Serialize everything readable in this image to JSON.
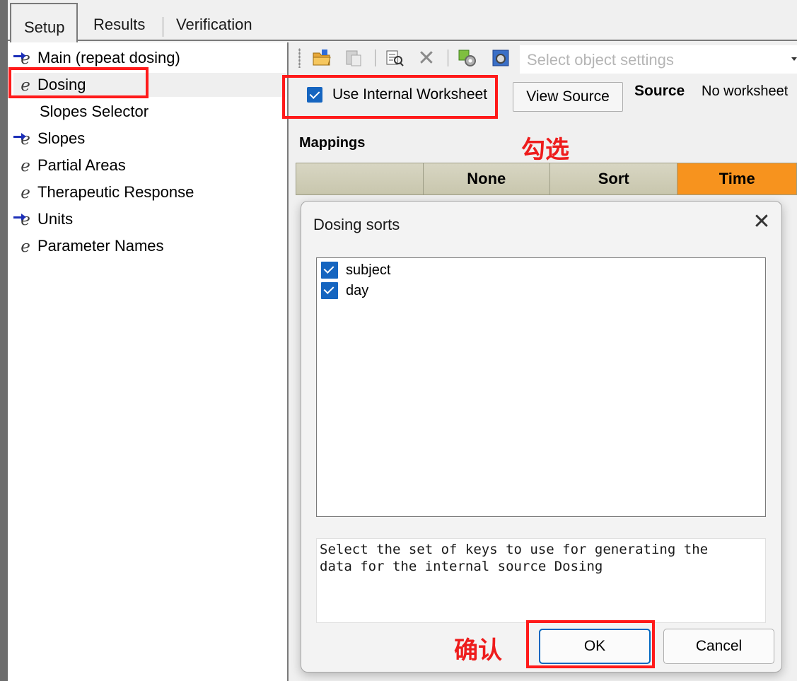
{
  "tabs": [
    {
      "label": "Setup"
    },
    {
      "label": "Results"
    },
    {
      "label": "Verification"
    }
  ],
  "tree": {
    "items": [
      {
        "label": "Main (repeat dosing)",
        "icon": "mapped-arrow-icon"
      },
      {
        "label": "Dosing",
        "icon": "mapped-icon"
      },
      {
        "label": "Slopes Selector",
        "icon": ""
      },
      {
        "label": "Slopes",
        "icon": "mapped-arrow-icon"
      },
      {
        "label": "Partial Areas",
        "icon": "mapped-icon"
      },
      {
        "label": "Therapeutic Response",
        "icon": "mapped-icon"
      },
      {
        "label": "Units",
        "icon": "mapped-arrow-icon"
      },
      {
        "label": "Parameter Names",
        "icon": "mapped-icon"
      }
    ]
  },
  "toolbar": {
    "select_placeholder": "Select object settings"
  },
  "worksheet": {
    "use_internal_label": "Use Internal Worksheet",
    "use_internal_checked": true,
    "view_source_label": "View Source",
    "source_label": "Source",
    "source_value": "No worksheet"
  },
  "mappings": {
    "label": "Mappings",
    "columns": [
      "",
      "None",
      "Sort",
      "Time"
    ]
  },
  "annotations": {
    "check_note": "勾选",
    "confirm_note": "确认",
    "color": "#ee1c1c"
  },
  "dialog": {
    "title": "Dosing sorts",
    "items": [
      {
        "label": "subject",
        "checked": true
      },
      {
        "label": "day",
        "checked": true
      }
    ],
    "description_line1": "Select the set of keys to use for generating the",
    "description_line2": "data for the internal source Dosing",
    "ok_label": "OK",
    "cancel_label": "Cancel"
  },
  "colors": {
    "accent": "#1565c0",
    "time_column": "#f7931e",
    "header_column": "#d8d6c3"
  }
}
